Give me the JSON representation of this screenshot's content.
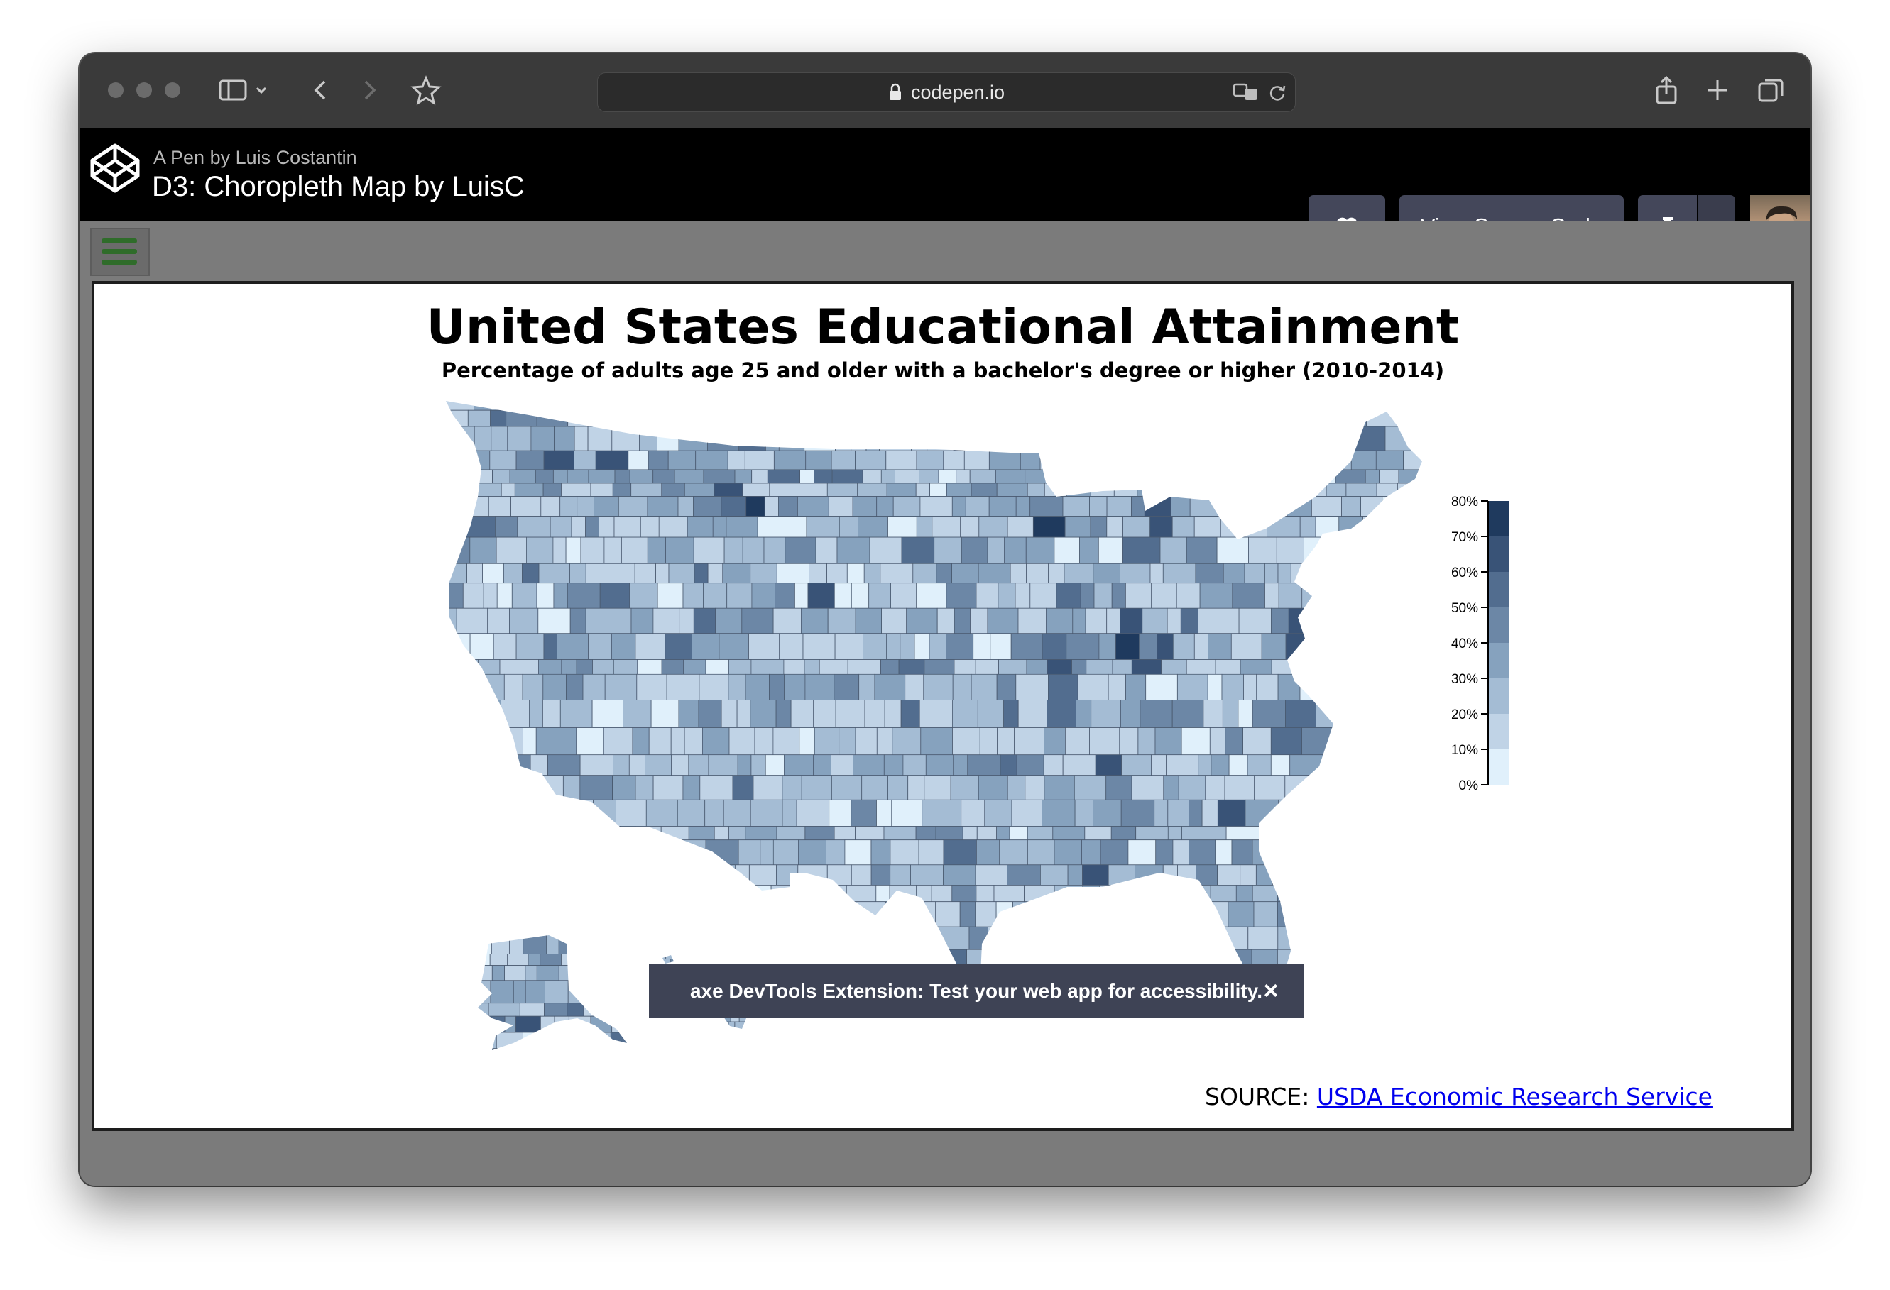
{
  "browser": {
    "url": "codepen.io",
    "toolbar_icons": [
      "sidebar-icon",
      "chevron-down-icon",
      "back-icon",
      "forward-icon",
      "star-icon",
      "translate-icon",
      "reload-icon",
      "share-icon",
      "plus-icon",
      "tabs-icon"
    ]
  },
  "codepen": {
    "author_line": "A Pen by Luis Costantin",
    "pen_title": "D3: Choropleth Map by LuisC",
    "view_source_label": "View Source Code",
    "buttons": [
      "heart-icon",
      "pin-icon",
      "chevron-down-icon"
    ]
  },
  "chart_data": {
    "type": "choropleth",
    "title": "United States Educational Attainment",
    "subtitle": "Percentage of adults age 25 and older with a bachelor's degree or higher (2010-2014)",
    "legend": {
      "position": "right",
      "ticks": [
        "80%",
        "70%",
        "60%",
        "50%",
        "40%",
        "30%",
        "20%",
        "10%",
        "0%"
      ],
      "bins": [
        {
          "range": [
            0,
            10
          ],
          "color": "#e0f0fb"
        },
        {
          "range": [
            10,
            20
          ],
          "color": "#c0d3e6"
        },
        {
          "range": [
            20,
            30
          ],
          "color": "#a4bcd4"
        },
        {
          "range": [
            30,
            40
          ],
          "color": "#86a2be"
        },
        {
          "range": [
            40,
            50
          ],
          "color": "#6c87a6"
        },
        {
          "range": [
            50,
            60
          ],
          "color": "#526d8f"
        },
        {
          "range": [
            60,
            70
          ],
          "color": "#395377"
        },
        {
          "range": [
            70,
            80
          ],
          "color": "#1f3a5e"
        }
      ]
    },
    "source_label": "SOURCE:",
    "source_link_text": "USDA Economic Research Service"
  },
  "axe_banner": {
    "text": "axe DevTools Extension: Test your web app for accessibility.",
    "close_label": "×"
  }
}
